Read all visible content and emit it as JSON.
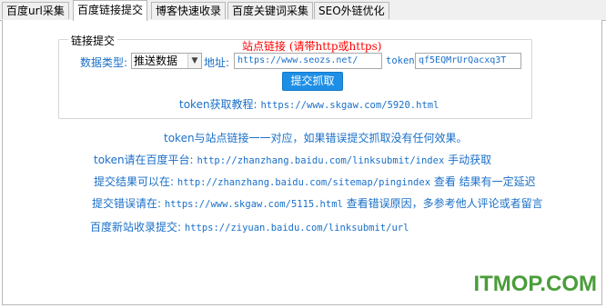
{
  "tabs": [
    {
      "label": "百度url采集"
    },
    {
      "label": "百度链接提交"
    },
    {
      "label": "博客快速收录"
    },
    {
      "label": "百度关键词采集"
    },
    {
      "label": "SEO外链优化"
    }
  ],
  "group": {
    "legend": "链接提交",
    "site_link_title": "站点链接 (请带http或https)",
    "data_type_label": "数据类型:",
    "data_type_value": "推送数据",
    "address_label": "地址:",
    "address_value": "https://www.seozs.net/",
    "token_label": "token:",
    "token_value": "qf5EQMrUrQacxq3T",
    "submit_label": "提交抓取",
    "tutorial_label": "token获取教程:",
    "tutorial_url": "https://www.skgaw.com/5920.html"
  },
  "info": {
    "line1": "token与站点链接一一对应，如果错误提交抓取没有任何效果。",
    "line2_label": "token请在百度平台:",
    "line2_url": "http://zhanzhang.baidu.com/linksubmit/index",
    "line2_suffix": "手动获取",
    "line3_label": "提交结果可以在:",
    "line3_url": "http://zhanzhang.baidu.com/sitemap/pingindex",
    "line3_suffix": "查看 结果有一定延迟",
    "line4_label": "提交错误请在:",
    "line4_url": "https://www.skgaw.com/5115.html",
    "line4_suffix": "查看错误原因，多参考他人评论或者留言",
    "line5_label": "百度新站收录提交:",
    "line5_url": "https://ziyuan.baidu.com/linksubmit/url"
  },
  "watermark": "ITMOP.COM",
  "colors": {
    "accent": "#1a6fc8",
    "button": "#1e8fe6",
    "red_title": "#ff0000",
    "watermark": "#4a9d3a"
  }
}
